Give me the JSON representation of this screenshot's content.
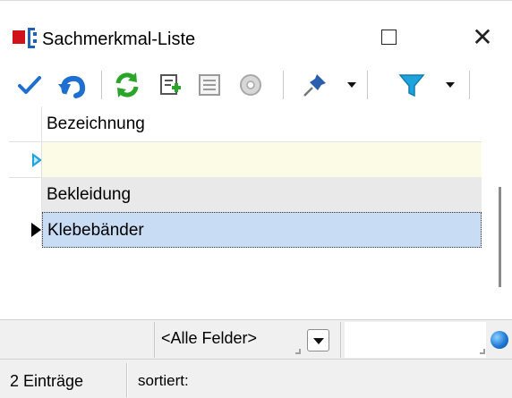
{
  "window": {
    "title": "Sachmerkmal-Liste",
    "maximize_icon": "maximize-icon",
    "close_glyph": "✕"
  },
  "toolbar": {
    "items": [
      {
        "name": "confirm-check-icon",
        "color": "#1f6fd0"
      },
      {
        "name": "undo-icon",
        "color": "#1f6fd0"
      },
      {
        "name": "refresh-icon",
        "color": "#2aa52a"
      },
      {
        "name": "new-entry-icon",
        "color": "#2aa52a"
      },
      {
        "name": "details-list-icon",
        "color": "#9a9a9a"
      },
      {
        "name": "disc-icon",
        "color": "#b0b0b0"
      },
      {
        "name": "pin-icon",
        "color": "#2a5fb0"
      },
      {
        "name": "filter-icon",
        "color": "#1fa3dc"
      }
    ]
  },
  "grid": {
    "column_header": "Bezeichnung",
    "new_row_value": "",
    "rows": [
      {
        "value": "Bekleidung",
        "selected": false
      },
      {
        "value": "Klebebänder",
        "selected": true
      }
    ]
  },
  "filterbar": {
    "field_selector": "<Alle Felder>",
    "search_value": ""
  },
  "status": {
    "count": "2 Einträge",
    "sort": "sortiert:"
  },
  "colors": {
    "selection": "#c8dcf4",
    "new_row": "#fbfbe6",
    "row_alt": "#e9e9e9",
    "brand_red": "#d0121b",
    "brand_blue": "#1e62b8"
  }
}
